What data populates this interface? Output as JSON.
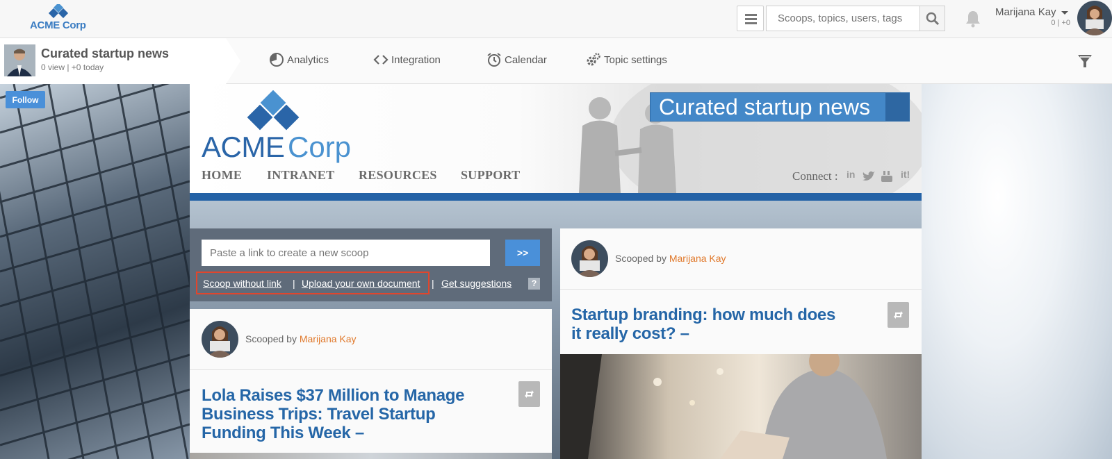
{
  "header": {
    "logo_text": "ACME Corp",
    "search_placeholder": "Scoops, topics, users, tags",
    "user_name": "Marijana Kay",
    "user_stats": "0 | +0"
  },
  "topic": {
    "title": "Curated startup news",
    "stats": "0 view | +0 today",
    "nav": [
      {
        "label": "Analytics",
        "icon": "pie-chart-icon"
      },
      {
        "label": "Integration",
        "icon": "code-icon"
      },
      {
        "label": "Calendar",
        "icon": "alarm-clock-icon"
      },
      {
        "label": "Topic settings",
        "icon": "gear-icon"
      }
    ]
  },
  "follow_label": "Follow",
  "banner": {
    "logo_word1": "ACME",
    "logo_word2": "Corp",
    "title": "Curated startup news",
    "nav": [
      "HOME",
      "INTRANET",
      "RESOURCES",
      "SUPPORT"
    ],
    "connect_label": "Connect :",
    "social": [
      "in",
      "twitter",
      "YouTube",
      "it!"
    ]
  },
  "scoop_panel": {
    "input_placeholder": "Paste a link to create a new scoop",
    "go_label": ">>",
    "link_without": "Scoop without link",
    "link_upload": "Upload your own document",
    "link_suggestions": "Get suggestions",
    "separator": "|",
    "help": "?"
  },
  "posts": [
    {
      "scooped_prefix": "Scooped by",
      "author": "Marijana Kay",
      "title_lines": [
        "Lola Raises $37 Million to Manage",
        "Business Trips: Travel Startup",
        "Funding This Week –"
      ]
    },
    {
      "scooped_prefix": "Scooped by",
      "author": "Marijana Kay",
      "title_lines": [
        "Startup branding: how much does",
        "it really cost? –"
      ]
    }
  ],
  "colors": {
    "accent_blue": "#4a90d9",
    "title_blue": "#2566a7",
    "author_orange": "#e0782a",
    "highlight_red": "#e0462d"
  }
}
